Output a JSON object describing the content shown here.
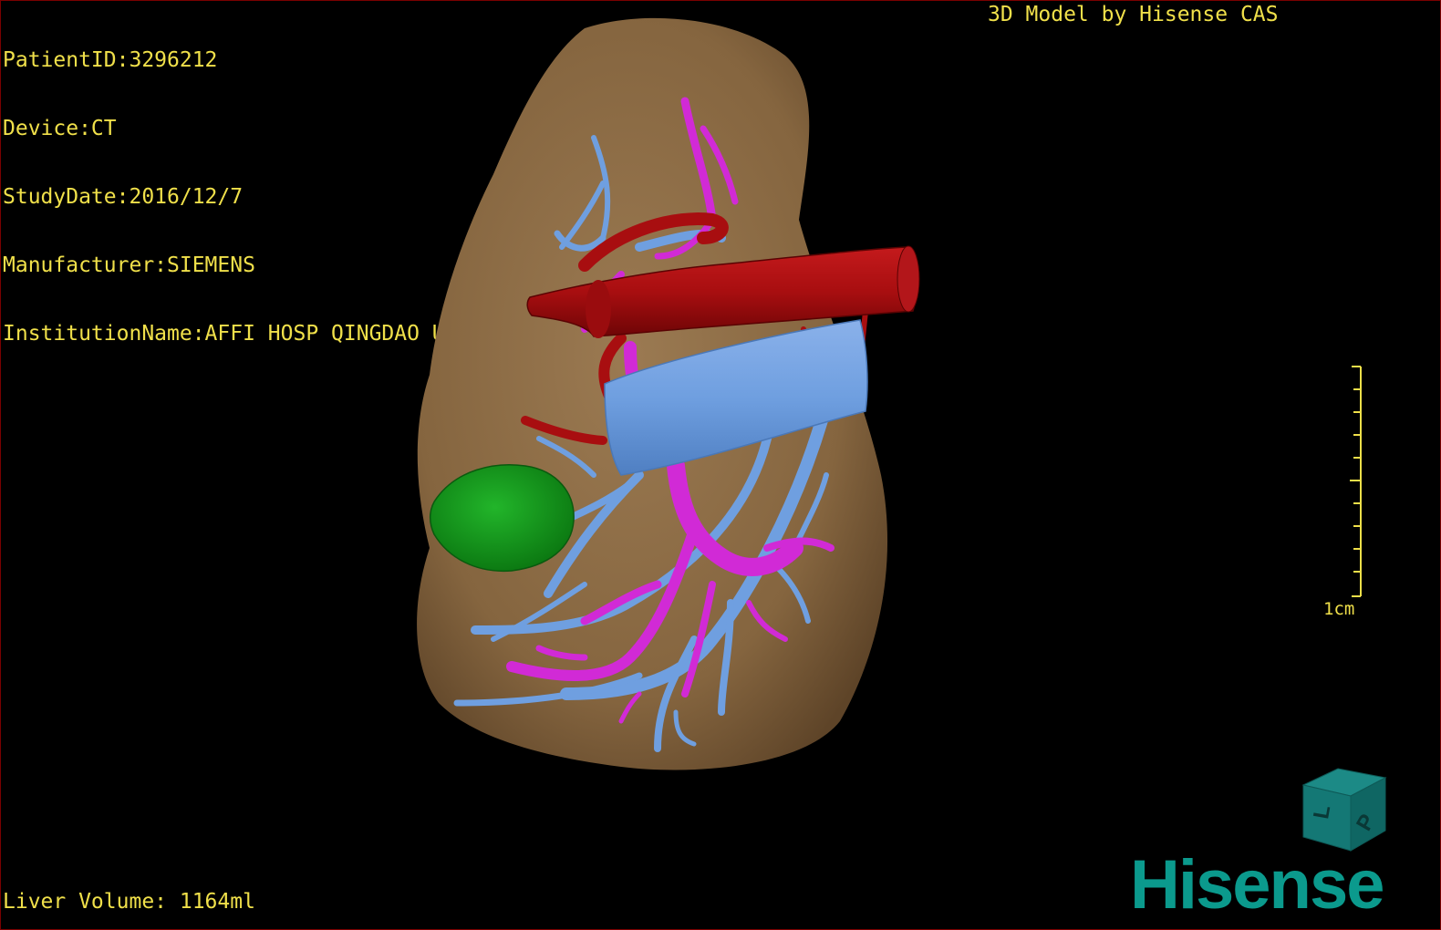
{
  "patient_info": [
    "PatientID:3296212",
    "Device:CT",
    "StudyDate:2016/12/7",
    "Manufacturer:SIEMENS",
    "InstitutionName:AFFI HOSP QINGDAO UNI"
  ],
  "credit": "3D Model by Hisense CAS",
  "liver_volume": "Liver Volume: 1164ml",
  "scale_label": "1cm",
  "orientation_cube": {
    "front_label": "P",
    "side_label": "L"
  },
  "logo": "Hisense",
  "colors": {
    "overlay_text": "#f0e04a",
    "liver": "#8a6a44",
    "artery": "#a80e10",
    "portal_vein": "#d12ad6",
    "hepatic_vein": "#6f9fe0",
    "tumor": "#149a1a",
    "brand": "#0b9a8d"
  }
}
